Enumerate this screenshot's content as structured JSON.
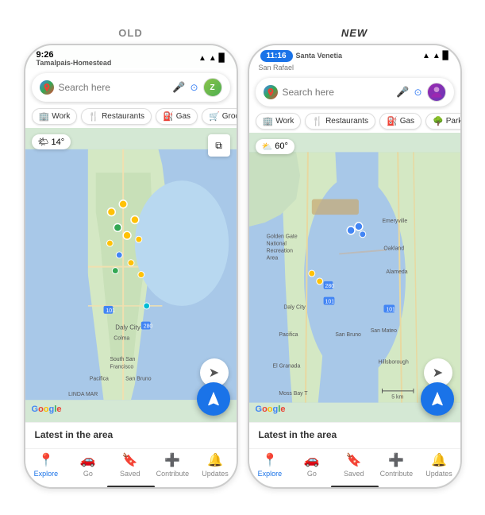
{
  "labels": {
    "old": "OLD",
    "new": "NEW"
  },
  "old_phone": {
    "status": {
      "time": "9:26",
      "location": "Tamalpais-Homestead",
      "signal_icons": "▲ ■ ●"
    },
    "search": {
      "placeholder": "Search here",
      "mic_icon": "🎤",
      "lens_icon": "⊙",
      "avatar_letter": "Z"
    },
    "chips": [
      "Work",
      "Restaurants",
      "Gas",
      "Groceries"
    ],
    "chip_icons": [
      "🏢",
      "🍴",
      "⛽",
      "🛒"
    ],
    "weather": {
      "temp": "14°",
      "icon": "🌤"
    },
    "map": {
      "google_text": "Google"
    },
    "latest_title": "Latest in the area",
    "nav_items": [
      {
        "label": "Explore",
        "icon": "📍",
        "active": true
      },
      {
        "label": "Go",
        "icon": "🚗",
        "active": false
      },
      {
        "label": "Saved",
        "icon": "🔖",
        "active": false
      },
      {
        "label": "Contribute",
        "icon": "➕",
        "active": false
      },
      {
        "label": "Updates",
        "icon": "🔔",
        "active": false
      }
    ]
  },
  "new_phone": {
    "status": {
      "time": "11:16",
      "location": "Santa Venetia",
      "sub_location": "San Rafael",
      "signal_icons": "▲ ■ ●"
    },
    "search": {
      "placeholder": "Search here",
      "mic_icon": "🎤",
      "lens_icon": "⊙"
    },
    "chips": [
      "Work",
      "Restaurants",
      "Gas",
      "Parks"
    ],
    "chip_icons": [
      "🏢",
      "🍴",
      "⛽",
      "🌳"
    ],
    "weather": {
      "temp": "60°",
      "icon": "⛅"
    },
    "map": {
      "google_text": "Google",
      "scale": "5 km"
    },
    "latest_title": "Latest in the area",
    "nav_items": [
      {
        "label": "Explore",
        "icon": "📍",
        "active": true
      },
      {
        "label": "Go",
        "icon": "🚗",
        "active": false
      },
      {
        "label": "Saved",
        "icon": "🔖",
        "active": false
      },
      {
        "label": "Contribute",
        "icon": "➕",
        "active": false
      },
      {
        "label": "Updates",
        "icon": "🔔",
        "active": false
      }
    ]
  }
}
